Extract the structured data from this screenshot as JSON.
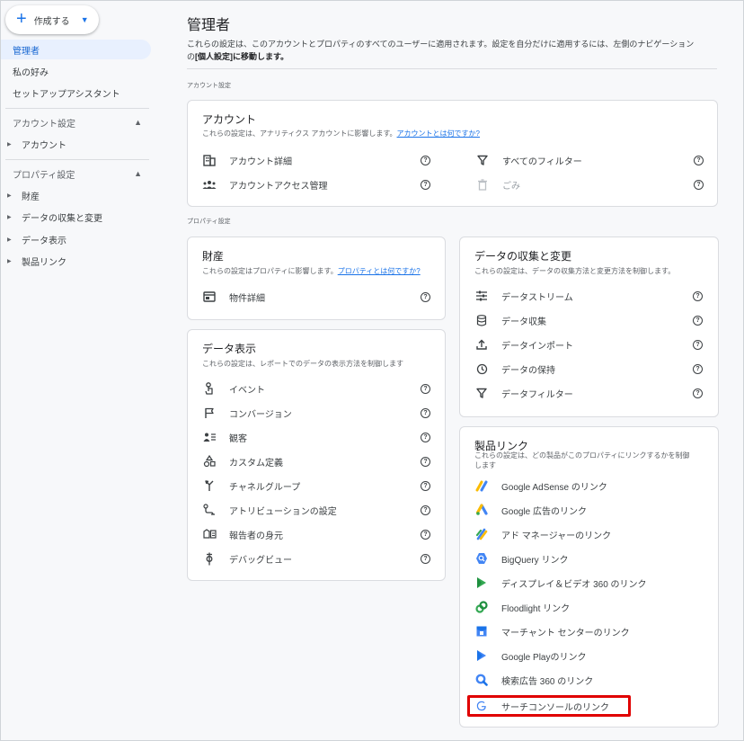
{
  "sidebar": {
    "create_label": "作成する",
    "items": [
      {
        "label": "管理者",
        "active": true
      },
      {
        "label": "私の好み"
      },
      {
        "label": "セットアップアシスタント"
      }
    ],
    "account_section": {
      "label": "アカウント設定",
      "items": [
        "アカウント"
      ]
    },
    "property_section": {
      "label": "プロパティ設定",
      "items": [
        "財産",
        "データの収集と変更",
        "データ表示",
        "製品リンク"
      ]
    }
  },
  "main": {
    "title": "管理者",
    "desc_line1": "これらの設定は、このアカウントとプロパティのすべてのユーザーに適用されます。設定を自分だけに適用するには、左側のナビゲーション",
    "desc_line2_pre": "の",
    "desc_line2_bold": "[個人設定]に移動します。",
    "account_settings_label": "アカウント設定",
    "property_settings_label": "プロパティ設定"
  },
  "account_card": {
    "title": "アカウント",
    "desc": "これらの設定は、アナリティクス アカウントに影響します。",
    "desc_link": "アカウントとは何ですか?",
    "left_items": [
      "アカウント詳細",
      "アカウントアクセス管理"
    ],
    "right_items": [
      "すべてのフィルター",
      "ごみ"
    ]
  },
  "property_card": {
    "title": "財産",
    "desc": "これらの設定はプロパティに影響します。",
    "desc_link": "プロパティとは何ですか?",
    "items": [
      "物件詳細"
    ]
  },
  "data_collection_card": {
    "title": "データの収集と変更",
    "desc": "これらの設定は、データの収集方法と変更方法を制御します。",
    "items": [
      "データストリーム",
      "データ収集",
      "データインポート",
      "データの保持",
      "データフィルター"
    ]
  },
  "data_display_card": {
    "title": "データ表示",
    "desc": "これらの設定は、レポートでのデータの表示方法を制御します",
    "items": [
      "イベント",
      "コンバージョン",
      "観客",
      "カスタム定義",
      "チャネルグループ",
      "アトリビューションの設定",
      "報告者の身元",
      "デバッグビュー"
    ]
  },
  "product_links_card": {
    "title": "製品リンク",
    "desc_line1": "これらの設定は、どの製品がこのプロパティにリンクするかを制御",
    "desc_line2": "します",
    "items": [
      "Google AdSense のリンク",
      "Google 広告のリンク",
      "アド マネージャーのリンク",
      "BigQuery リンク",
      "ディスプレイ＆ビデオ 360 のリンク",
      "Floodlight リンク",
      "マーチャント センターのリンク",
      "Google Playのリンク",
      "検索広告 360 のリンク",
      "サーチコンソールのリンク"
    ]
  },
  "help_glyph": "?",
  "colors": {
    "accent": "#1a73e8",
    "highlight": "#e00000",
    "active_bg": "#e8f0fe"
  }
}
